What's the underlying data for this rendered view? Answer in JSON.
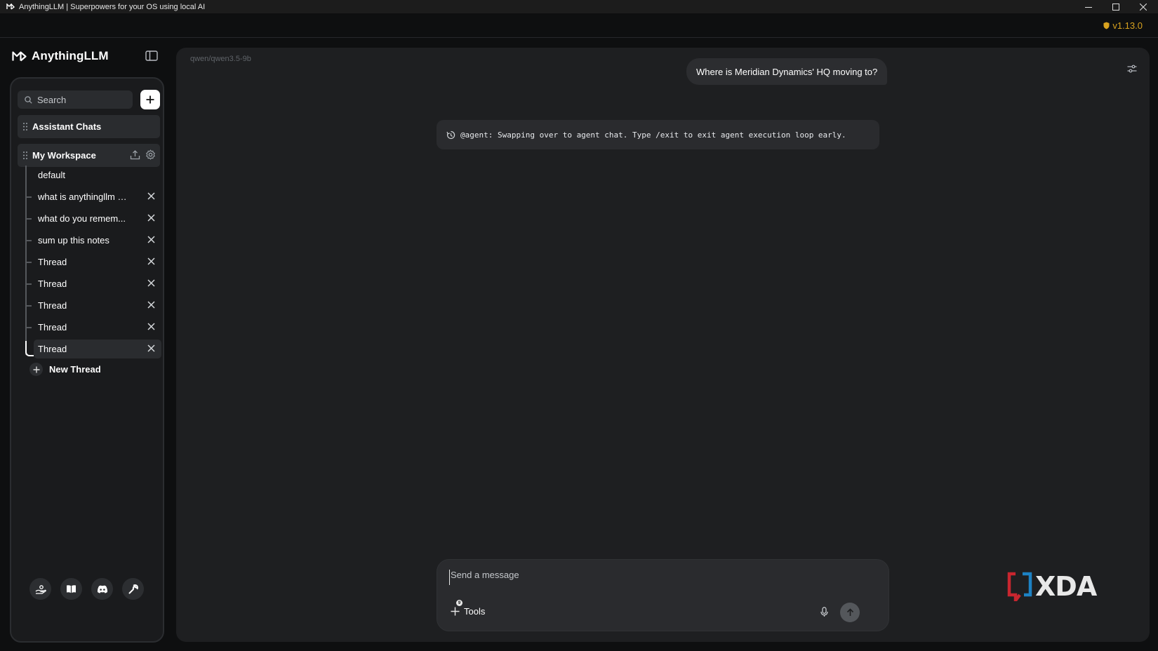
{
  "window": {
    "title": "AnythingLLM | Superpowers for your OS using local AI",
    "version": "v1.13.0",
    "controls": [
      "minimize",
      "maximize",
      "close"
    ]
  },
  "sidebar": {
    "brand": "AnythingLLM",
    "search_placeholder": "Search",
    "assistant_chats_label": "Assistant Chats",
    "workspace": {
      "name": "My Workspace",
      "threads": [
        {
          "label": "default",
          "closable": false,
          "active": false
        },
        {
          "label": "what is anythingllm a...",
          "closable": true,
          "active": false
        },
        {
          "label": "what do you remem...",
          "closable": true,
          "active": false
        },
        {
          "label": "sum up this notes",
          "closable": true,
          "active": false
        },
        {
          "label": "Thread",
          "closable": true,
          "active": false
        },
        {
          "label": "Thread",
          "closable": true,
          "active": false
        },
        {
          "label": "Thread",
          "closable": true,
          "active": false
        },
        {
          "label": "Thread",
          "closable": true,
          "active": false
        },
        {
          "label": "Thread",
          "closable": true,
          "active": true
        }
      ],
      "new_thread_label": "New Thread"
    },
    "footer_icons": [
      "community-hub-icon",
      "docs-book-icon",
      "discord-icon",
      "settings-wrench-icon"
    ]
  },
  "chat": {
    "model": "qwen/qwen3.5-9b",
    "user_message": "Where is Meridian Dynamics' HQ moving to?",
    "agent_message": "@agent: Swapping over to agent chat. Type /exit to exit agent execution loop early.",
    "input_placeholder": "Send a message",
    "tools_label": "Tools",
    "tools_badge": "9"
  },
  "watermark": {
    "text": "XDA"
  },
  "colors": {
    "background": "#0e0f10",
    "panel": "#1e1f21",
    "sidebar": "#1a1b1d",
    "accent_version": "#d8a21f",
    "watermark_red": "#c8262f",
    "watermark_blue": "#1d82c4"
  }
}
